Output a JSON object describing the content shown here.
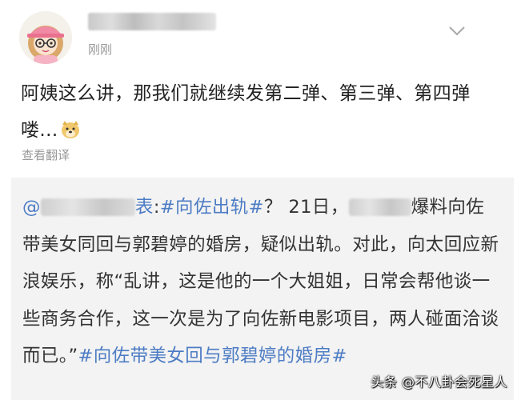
{
  "post": {
    "timestamp": "刚刚",
    "text": "阿姨这么讲，那我们就继续发第二弹、第三弹、第四弹喽...",
    "emoji_icon": "doge-emoji-icon",
    "translate_label": "查看翻译"
  },
  "repost": {
    "mention_prefix": "@",
    "mention_tail": "表",
    "colon": ":",
    "topic1": "#向佐出轨#",
    "text_a": "？ 21日，",
    "text_b": "爆料向佐带美女同回与郭碧婷的婚房，疑似出轨。对此，向太回应新浪娱乐，称“乱讲，这是他的一个大姐姐，日常会帮他谈一些商务合作，这一次是为了向佐新电影项目，两人碰面洽谈而已。”",
    "topic2": "#向佐带美女回与郭碧婷的婚房#"
  },
  "watermark": "头条 @不八卦会死星人",
  "colors": {
    "link": "#4d7cc4",
    "repost_bg": "#f3f3f3",
    "meta_text": "#9a9a9a"
  }
}
